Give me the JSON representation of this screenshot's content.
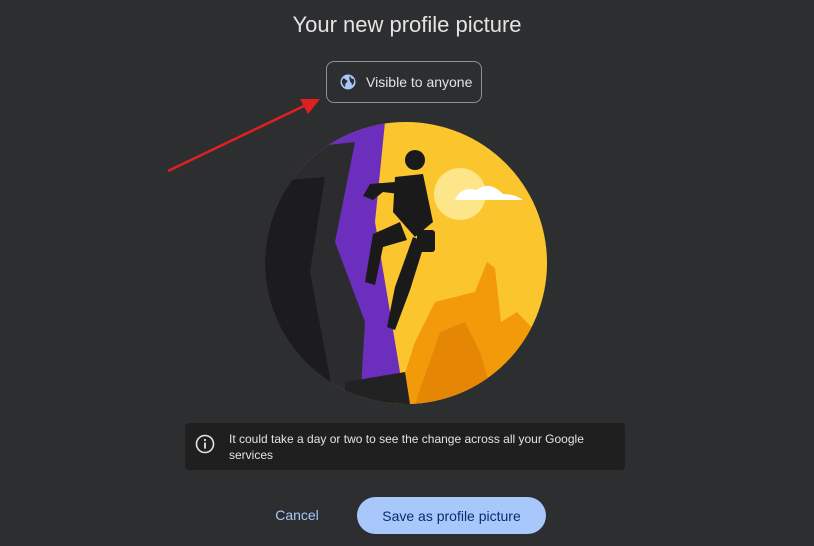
{
  "dialog": {
    "title": "Your new profile picture",
    "visibility_label": "Visible to anyone",
    "notice_text": "It could take a day or two to see the change across all your Google services",
    "cancel_label": "Cancel",
    "save_label": "Save as profile picture"
  },
  "icons": {
    "visibility": "globe-icon",
    "notice": "info-icon"
  },
  "colors": {
    "background": "#2d2e30",
    "accent": "#a8c7fa",
    "annotation_arrow": "#e02020"
  }
}
